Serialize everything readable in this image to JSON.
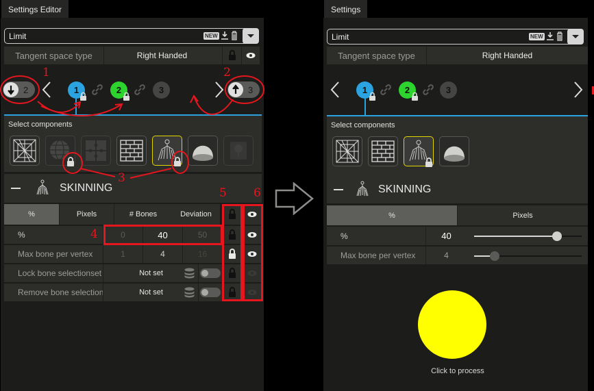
{
  "colors": {
    "accent_blue": "#2ba3e0",
    "lod_green": "#2ed42e",
    "annotation_red": "#e5161e",
    "selected_border": "#e3d600",
    "process_yellow": "#ffff00"
  },
  "before": {
    "tab_title": "Settings Editor",
    "preset": {
      "name": "Limit",
      "badge": "NEW",
      "icons": [
        "download-icon",
        "trash-icon",
        "dropdown-icon"
      ]
    },
    "tangent": {
      "label": "Tangent space type",
      "value": "Right Handed"
    },
    "lod_nav": {
      "left_toggle": {
        "icon": "arrow-down-icon",
        "value": "2"
      },
      "right_toggle": {
        "icon": "arrow-up-icon",
        "value": "3"
      },
      "levels": [
        {
          "label": "1",
          "locked": true,
          "active": true
        },
        {
          "label": "2",
          "locked": true,
          "active": false
        },
        {
          "label": "3",
          "locked": false,
          "active": false
        }
      ]
    },
    "components": {
      "label": "Select components",
      "items": [
        {
          "name": "wireframe",
          "locked": false,
          "selected": false,
          "enabled": true
        },
        {
          "name": "sphere-mesh",
          "locked": true,
          "selected": false,
          "enabled": false
        },
        {
          "name": "puzzle",
          "locked": false,
          "selected": false,
          "enabled": false
        },
        {
          "name": "brick-texture",
          "locked": false,
          "selected": false,
          "enabled": true
        },
        {
          "name": "skinning",
          "locked": true,
          "selected": true,
          "enabled": true
        },
        {
          "name": "hemisphere",
          "locked": false,
          "selected": false,
          "enabled": true
        },
        {
          "name": "impostor",
          "locked": false,
          "selected": false,
          "enabled": false
        }
      ]
    },
    "skinning": {
      "title": "SKINNING",
      "tabs": [
        "%",
        "Pixels",
        "# Bones",
        "Deviation"
      ],
      "active_tab": "%",
      "rows": [
        {
          "label": "%",
          "min": "0",
          "value": "40",
          "max": "50"
        },
        {
          "label": "Max bone per vertex",
          "min": "1",
          "value": "4",
          "max": "16"
        },
        {
          "label": "Lock bone selectionset",
          "value": "Not set"
        },
        {
          "label": "Remove bone selection",
          "value": "Not set"
        }
      ]
    },
    "annotations": [
      "1",
      "2",
      "3",
      "4",
      "5",
      "6"
    ]
  },
  "after": {
    "tab_title": "Settings",
    "preset": {
      "name": "Limit",
      "badge": "NEW"
    },
    "tangent": {
      "label": "Tangent space type",
      "value": "Right Handed"
    },
    "levels": [
      "1",
      "2",
      "3"
    ],
    "components": {
      "label": "Select components"
    },
    "skinning": {
      "title": "SKINNING",
      "tabs": [
        "%",
        "Pixels"
      ],
      "active_tab": "%",
      "rows": [
        {
          "label": "%",
          "value": "40",
          "slider_fraction": 0.77
        },
        {
          "label": "Max bone per vertex",
          "value": "4",
          "slider_fraction": 0.19
        }
      ]
    },
    "process": {
      "caption": "Click to process"
    }
  }
}
